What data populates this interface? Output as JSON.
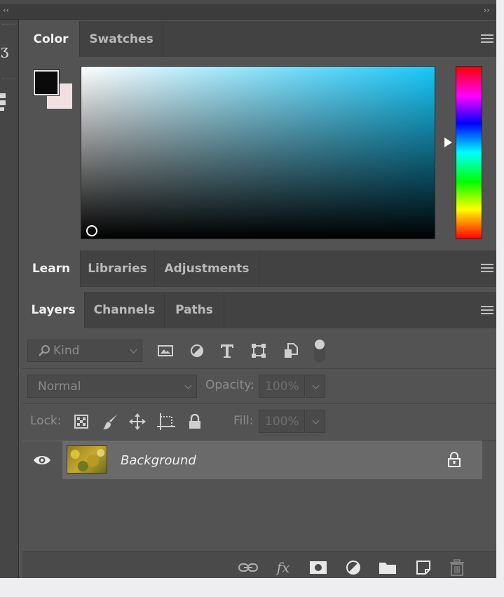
{
  "top_strip": {
    "collapse_left": "‹‹",
    "collapse_right": "››"
  },
  "color_panel": {
    "tabs": [
      {
        "label": "Color",
        "active": true
      },
      {
        "label": "Swatches",
        "active": false
      }
    ],
    "foreground_color": "#0a0a0a",
    "background_color": "#f2dfe1",
    "field_hue_color": "#18c8fb"
  },
  "learn_panel": {
    "tabs": [
      {
        "label": "Learn",
        "active": true
      },
      {
        "label": "Libraries",
        "active": false
      },
      {
        "label": "Adjustments",
        "active": false
      }
    ]
  },
  "layers_panel": {
    "tabs": [
      {
        "label": "Layers",
        "active": true
      },
      {
        "label": "Channels",
        "active": false
      },
      {
        "label": "Paths",
        "active": false
      }
    ],
    "filter": {
      "kind_label": "Kind",
      "icons": [
        "image-filter-icon",
        "adjustment-filter-icon",
        "type-filter-icon",
        "shape-filter-icon",
        "smart-object-filter-icon",
        "filter-toggle-icon"
      ]
    },
    "blend_mode": "Normal",
    "opacity_label": "Opacity:",
    "opacity_value": "100%",
    "lock_label": "Lock:",
    "fill_label": "Fill:",
    "fill_value": "100%",
    "layers": [
      {
        "name": "Background",
        "visible": true,
        "locked": true
      }
    ],
    "footer_icons": [
      "link-layers-icon",
      "fx-icon",
      "mask-icon",
      "adjustment-icon",
      "group-folder-icon",
      "new-layer-icon",
      "trash-icon"
    ],
    "fx_label": "fx"
  }
}
